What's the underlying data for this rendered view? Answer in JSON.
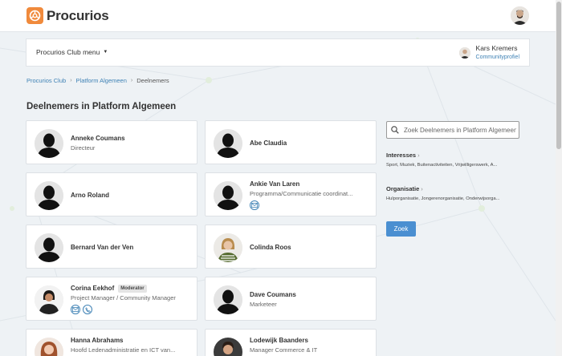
{
  "app": {
    "logo_text": "Procurios",
    "brand_color": "#f08a3c",
    "link_color": "#3f82b5",
    "button_color": "#4a8fd1"
  },
  "menubar": {
    "club_menu_label": "Procurios Club menu",
    "user_name": "Kars Kremers",
    "profile_link": "Communityprofiel"
  },
  "breadcrumb": {
    "items": [
      "Procurios Club",
      "Platform Algemeen"
    ],
    "current": "Deelnemers"
  },
  "page_title": "Deelnemers in Platform Algemeen",
  "members": [
    {
      "name": "Anneke Coumans",
      "role": "Directeur",
      "avatar": "silhouette"
    },
    {
      "name": "Abe Claudia",
      "role": "",
      "avatar": "silhouette"
    },
    {
      "name": "Arno Roland",
      "role": "",
      "avatar": "silhouette"
    },
    {
      "name": "Ankie Van Laren",
      "role": "Programma/Communicatie coordinat...",
      "avatar": "silhouette",
      "icons": [
        "mail-icon"
      ]
    },
    {
      "name": "Bernard Van der Ven",
      "role": "",
      "avatar": "silhouette"
    },
    {
      "name": "Colinda Roos",
      "role": "",
      "avatar": "photo"
    },
    {
      "name": "Corina Eekhof",
      "badge": "Moderator",
      "role": "Project Manager / Community Manager",
      "avatar": "photo",
      "icons": [
        "mail-icon",
        "phone-icon"
      ]
    },
    {
      "name": "Dave Coumans",
      "role": "Marketeer",
      "avatar": "silhouette"
    },
    {
      "name": "Hanna Abrahams",
      "role": "Hoofd Ledenadministratie en ICT van...",
      "avatar": "photo"
    },
    {
      "name": "Lodewijk Baanders",
      "role": "Manager Commerce & IT",
      "avatar": "photo"
    }
  ],
  "sidebar": {
    "search_placeholder": "Zoek Deelnemers in Platform Algemeen",
    "filters": [
      {
        "title": "Interesses",
        "values": "Sport, Muziek, Buitenactiviteiten, Vrijwilligerswerk, A..."
      },
      {
        "title": "Organisatie",
        "values": "Hulporganisatie, Jongerenorganisatie, Onderwijsorga..."
      }
    ],
    "search_button": "Zoek"
  }
}
